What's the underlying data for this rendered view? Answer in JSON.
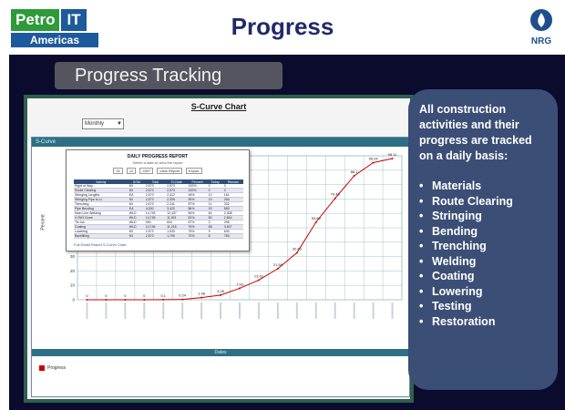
{
  "header": {
    "logo_petro": "Petro",
    "logo_it": "IT",
    "logo_region": "Americas",
    "title": "Progress",
    "nrg_logo_text": "NRG"
  },
  "section": {
    "label": "Progress Tracking"
  },
  "screenshot": {
    "chart_heading": "S-Curve Chart",
    "period_select": "Monthly",
    "chart_bar_label": "S-Curve",
    "x_axis_title": "Dates",
    "y_axis_title": "Percent",
    "legend_label": "Progress",
    "report": {
      "title": "DAILY PROGRESS REPORT",
      "subtitle": "Select a date to view the report",
      "controls": [
        "01",
        "12",
        "2007",
        "View Report",
        "Export"
      ],
      "columns": [
        "Activity",
        "UOM",
        "Total",
        "To Date",
        "Percent",
        "Today",
        "Remain"
      ],
      "rows": [
        [
          "Right of Way",
          "MI",
          "2,573",
          "2,573",
          "100%",
          "0",
          "0"
        ],
        [
          "Route Clearing",
          "MI",
          "2,573",
          "2,573",
          "100%",
          "0",
          "0"
        ],
        [
          "Stringing Lengths",
          "EA",
          "2,573",
          "2,412",
          "94%",
          "12",
          "161"
        ],
        [
          "Stringing Pipe to Lt.",
          "MI",
          "2,573",
          "2,309",
          "90%",
          "10",
          "264"
        ],
        [
          "Trenching",
          "MI",
          "2,573",
          "2,241",
          "87%",
          "11",
          "332"
        ],
        [
          "Pipe Bending",
          "EA",
          "4,000",
          "3,420",
          "86%",
          "20",
          "580"
        ],
        [
          "Main Line Welding",
          "WLD",
          "14,745",
          "12,437",
          "84%",
          "64",
          "2,308"
        ],
        [
          "X-RAY Done",
          "WLD",
          "14,745",
          "11,901",
          "81%",
          "60",
          "2,844"
        ],
        [
          "Tie-Ins",
          "WLD",
          "900",
          "604",
          "67%",
          "3",
          "296"
        ],
        [
          "Coating",
          "WLD",
          "14,745",
          "11,218",
          "76%",
          "58",
          "3,527"
        ],
        [
          "Lowering",
          "MI",
          "2,573",
          "1,933",
          "75%",
          "9",
          "640"
        ],
        [
          "Backfilling",
          "MI",
          "2,573",
          "1,790",
          "70%",
          "8",
          "783"
        ]
      ],
      "footer": "Full Detail Report      S-Curve Chart"
    }
  },
  "chart_data": {
    "type": "line",
    "title": "S-Curve Chart",
    "xlabel": "Dates",
    "ylabel": "Percent",
    "ylim": [
      0,
      100
    ],
    "y_ticks": [
      0,
      10,
      20,
      30,
      40,
      50,
      60,
      70,
      80,
      90,
      100
    ],
    "series": [
      {
        "name": "Progress",
        "color": "#cc0000",
        "values": [
          0,
          0,
          0,
          0,
          0.1,
          0.24,
          1.48,
          3.26,
          7.93,
          13.62,
          21.58,
          32.63,
          53.89,
          70.45,
          86.1,
          95.24,
          98.11
        ]
      }
    ]
  },
  "callout": {
    "intro": "All construction activities and their progress are tracked on a daily basis:",
    "bullet": "•",
    "items": [
      "Materials",
      "Route Clearing",
      "Stringing",
      "Bending",
      "Trenching",
      "Welding",
      "Coating",
      "Lowering",
      "Testing",
      "Restoration"
    ]
  },
  "colors": {
    "title": "#1f2a6b",
    "slide_bg": "#0b0b2e",
    "callout_bg": "#3b4e76",
    "petro_green": "#2e9a3a",
    "it_blue": "#1d5a9c",
    "curve": "#cc0000"
  }
}
